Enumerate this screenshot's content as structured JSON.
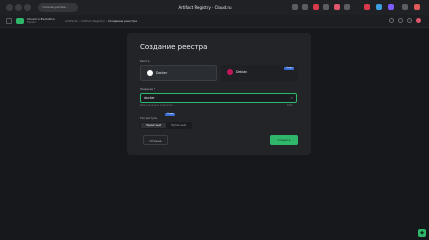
{
  "browser": {
    "url": "console.yandex...",
    "window_title": "Artifact Registry · Cloud.ru"
  },
  "app": {
    "name": "Cloud.ru Evolution",
    "subtitle": "Проект",
    "breadcrumbs": [
      "Artifacts",
      "Artifact Registry",
      "Создание реестра"
    ]
  },
  "form": {
    "title": "Создание реестра",
    "registry_label": "Реестр",
    "tiles": [
      {
        "label": "Docker",
        "color": "#ffffff",
        "selected": true
      },
      {
        "label": "Debian",
        "color": "#c2185b",
        "selected": false,
        "badge": "Скоро"
      }
    ],
    "name_label": "Название *",
    "name_value": "docker",
    "name_hint": "Имя уникально в проекте",
    "name_counter": "6/63",
    "access_label": "Тип доступа",
    "access_badge": "Скоро",
    "access_options": [
      "Приватный",
      "Публичный"
    ],
    "access_selected": 0,
    "cancel_label": "Отмена",
    "create_label": "Создать"
  },
  "colors": {
    "accent": "#2fb86b",
    "background": "#17181b",
    "card": "#222428"
  }
}
